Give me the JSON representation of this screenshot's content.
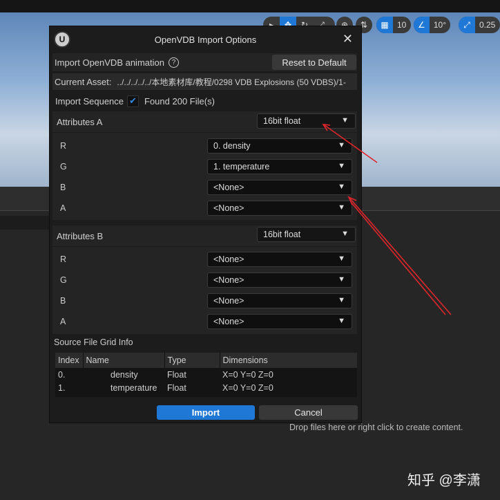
{
  "toolbar": {
    "grid_snap": "10",
    "rotation_snap": "10°",
    "scale_snap": "0.25"
  },
  "dialog": {
    "title": "OpenVDB Import Options",
    "import_animation_label": "Import OpenVDB animation",
    "reset_label": "Reset to Default",
    "current_asset_label": "Current Asset:",
    "current_asset_value": "../../../../../本地素材库/教程/0298   VDB Explosions (50 VDBS)/1-",
    "import_sequence_label": "Import Sequence",
    "import_sequence_checked": true,
    "found_files": "Found 200 File(s)",
    "attributes_a": {
      "label": "Attributes A",
      "format": "16bit float",
      "channels": [
        {
          "name": "R",
          "value": "0. density"
        },
        {
          "name": "G",
          "value": "1. temperature"
        },
        {
          "name": "B",
          "value": "<None>"
        },
        {
          "name": "A",
          "value": "<None>"
        }
      ]
    },
    "attributes_b": {
      "label": "Attributes B",
      "format": "16bit float",
      "channels": [
        {
          "name": "R",
          "value": "<None>"
        },
        {
          "name": "G",
          "value": "<None>"
        },
        {
          "name": "B",
          "value": "<None>"
        },
        {
          "name": "A",
          "value": "<None>"
        }
      ]
    },
    "grid_info": {
      "label": "Source File Grid Info",
      "headers": [
        "Index",
        "Name",
        "Type",
        "Dimensions"
      ],
      "rows": [
        [
          "0.",
          "density",
          "Float",
          "X=0 Y=0 Z=0"
        ],
        [
          "1.",
          "temperature",
          "Float",
          "X=0 Y=0 Z=0"
        ]
      ]
    },
    "import_label": "Import",
    "cancel_label": "Cancel"
  },
  "drop_hint": "Drop files here or right click to create content.",
  "watermark": "知乎 @李潇",
  "colors": {
    "accent": "#1f77d6",
    "arrow": "#e0262b"
  }
}
